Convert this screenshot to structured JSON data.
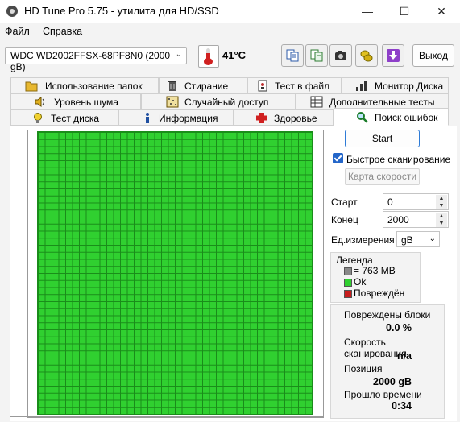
{
  "window": {
    "title": "HD Tune Pro 5.75 - утилита для HD/SSD"
  },
  "menu": {
    "file": "Файл",
    "help": "Справка"
  },
  "toolbar": {
    "drive": "WDC WD2002FFSX-68PF8N0 (2000 gB)",
    "temperature": "41°C",
    "exit": "Выход"
  },
  "tabs": {
    "row1": [
      "Использование папок",
      "Стирание",
      "Тест в файл",
      "Монитор Диска"
    ],
    "row2": [
      "Уровень шума",
      "Случайный доступ",
      "Дополнительные  тесты"
    ],
    "row3": [
      "Тест диска",
      "Информация",
      "Здоровье",
      "Поиск ошибок"
    ]
  },
  "errorscan": {
    "start_button": "Start",
    "quick_scan": "Быстрое сканирование",
    "quick_scan_checked": true,
    "speed_map_button": "Карта скорости",
    "start_label": "Старт",
    "start_value": "0",
    "end_label": "Конец",
    "end_value": "2000",
    "unit_label": "Ед.измерения",
    "unit_value": "gB",
    "legend": {
      "title": "Легенда",
      "block": "= 763 MB",
      "ok": "Ok",
      "damaged": "Повреждён",
      "ok_color": "#30d030",
      "damaged_color": "#c81e1e"
    },
    "stats": {
      "damaged_label": "Повреждены блоки",
      "damaged_value": "0.0 %",
      "speed_label": "Скорость сканирования",
      "speed_value": "n/a",
      "position_label": "Позиция",
      "position_value": "2000 gB",
      "elapsed_label": "Прошло времени",
      "elapsed_value": "0:34"
    }
  }
}
